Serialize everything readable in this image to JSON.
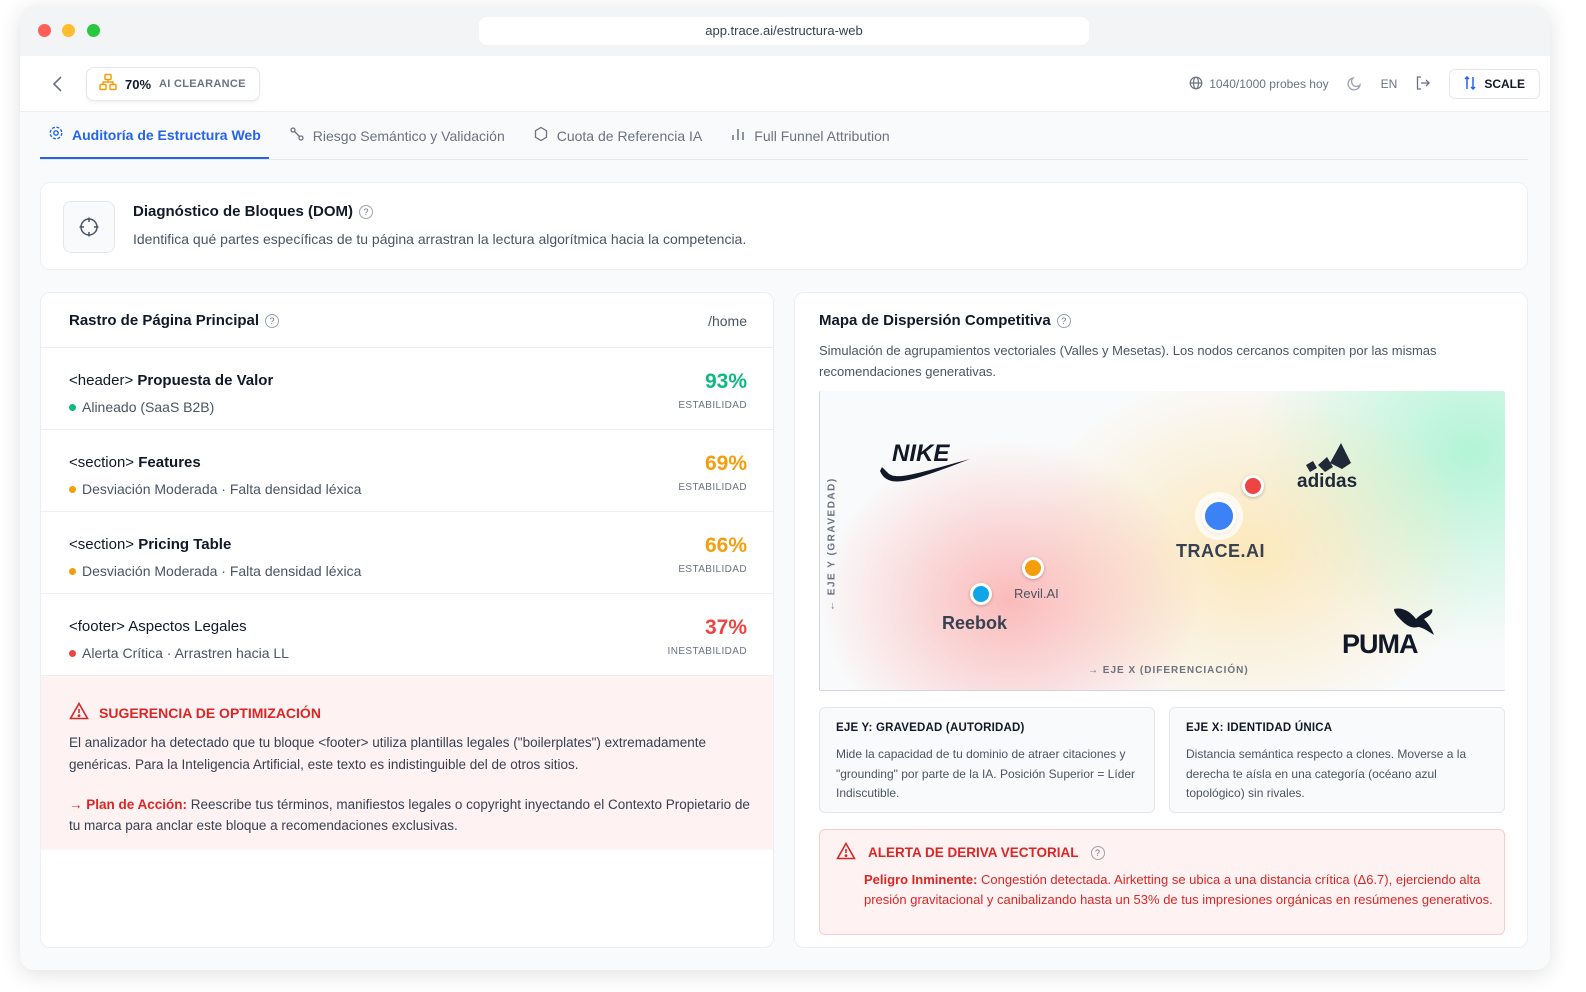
{
  "browser": {
    "url": "app.trace.ai/estructura-web"
  },
  "topbar": {
    "clearance_pct": "70%",
    "clearance_label": "AI CLEARANCE",
    "probes": "1040/1000 probes hoy",
    "lang": "EN",
    "scale_label": "SCALE"
  },
  "tabs": [
    {
      "label": "Auditoría de Estructura Web",
      "icon": "settings-scan-icon",
      "active": true
    },
    {
      "label": "Riesgo Semántico y Validación",
      "icon": "route-icon",
      "active": false
    },
    {
      "label": "Cuota de Referencia IA",
      "icon": "hexagon-icon",
      "active": false
    },
    {
      "label": "Full Funnel Attribution",
      "icon": "bar-chart-icon",
      "active": false
    }
  ],
  "diagnostic": {
    "title": "Diagnóstico de Bloques (DOM)",
    "description": "Identifica qué partes específicas de tu página arrastran la lectura algorítmica hacia la competencia."
  },
  "trace": {
    "title": "Rastro de Página Principal",
    "route": "/home",
    "rows": [
      {
        "tag": "<header>",
        "name": "Propuesta de Valor",
        "status": "Alineado (SaaS B2B)",
        "score": "93%",
        "score_label": "ESTABILIDAD",
        "color": "#10b981"
      },
      {
        "tag": "<section>",
        "name": "Features",
        "status": "Desviación Moderada · Falta densidad léxica",
        "score": "69%",
        "score_label": "ESTABILIDAD",
        "color": "#f59e0b"
      },
      {
        "tag": "<section>",
        "name": "Pricing Table",
        "status": "Desviación Moderada · Falta densidad léxica",
        "score": "66%",
        "score_label": "ESTABILIDAD",
        "color": "#f59e0b"
      },
      {
        "tag": "<footer>",
        "name": "Aspectos Legales",
        "status": "Alerta Crítica · Arrastren hacia LL",
        "score": "37%",
        "score_label": "INESTABILIDAD",
        "color": "#ef4444"
      }
    ],
    "suggestion": {
      "title": "SUGERENCIA DE OPTIMIZACIÓN",
      "text": "El analizador ha detectado que tu bloque <footer> utiliza plantillas legales (\"boilerplates\") extremadamente genéricas. Para la Inteligencia Artificial, este texto es indistinguible del de otros sitios.",
      "plan_lead": "→ Plan de Acción:",
      "plan_text": "Reescribe tus términos, manifiestos legales o copyright inyectando el Contexto Propietario de tu marca para anclar este bloque a recomendaciones exclusivas."
    }
  },
  "map": {
    "title": "Mapa de Dispersión Competitiva",
    "description": "Simulación de agrupamientos vectoriales (Valles y Mesetas). Los nodos cercanos compiten por las mismas recomendaciones generativas.",
    "axis_y": "← EJE Y (GRAVEDAD)",
    "axis_x": "→ EJE X (DIFERENCIACIÓN)",
    "brands": {
      "nike": "NIKE",
      "adidas": "adidas",
      "trace": "TRACE.AI",
      "reebok": "Reebok",
      "revil": "Revil.AI",
      "puma": "PUMA"
    },
    "info_y": {
      "title": "EJE Y: GRAVEDAD (AUTORIDAD)",
      "text": "Mide la capacidad de tu dominio de atraer citaciones y \"grounding\" por parte de la IA. Posición Superior = Líder Indiscutible."
    },
    "info_x": {
      "title": "EJE X: IDENTIDAD ÚNICA",
      "text": "Distancia semántica respecto a clones. Moverse a la derecha te aísla en una categoría (océano azul topológico) sin rivales."
    },
    "alert": {
      "title": "ALERTA DE DERIVA VECTORIAL",
      "lead": "Peligro Inminente:",
      "text": "Congestión detectada. Airketting se ubica a una distancia crítica (Δ6.7), ejerciendo alta presión gravitacional y canibalizando hasta un 53% de tus impresiones orgánicas en resúmenes generativos."
    }
  }
}
